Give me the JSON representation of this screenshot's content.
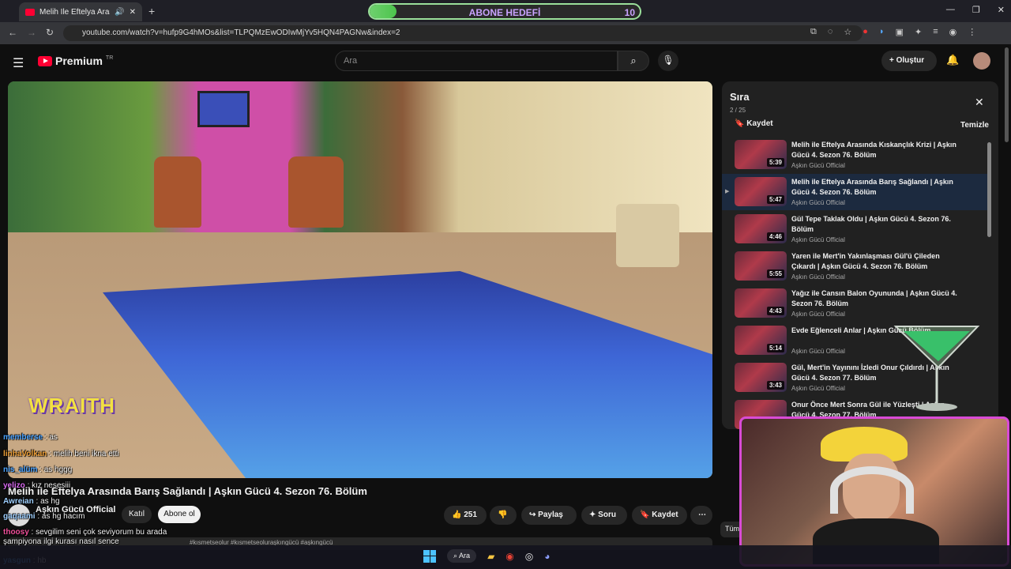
{
  "browser": {
    "tab_title": "Melih İle Eftelya Arasında B",
    "url": "youtube.com/watch?v=hufp9G4hMOs&list=TLPQMzEwODIwMjYv5HQN4PAGNw&index=2"
  },
  "overlay": {
    "sub_goal_label": "ABONE HEDEFİ",
    "sub_goal_count": "10",
    "sub_goal_progress": 0.1,
    "wraith_text": "WRAITH"
  },
  "header": {
    "logo_text": "Premium",
    "logo_region": "TR",
    "search_placeholder": "Ara",
    "create_label": "Oluştur"
  },
  "video": {
    "title": "Melih ile Eftelya Arasında Barış Sağlandı | Aşkın Gücü 4. Sezon 76. Bölüm",
    "channel": "Aşkın Gücü Official",
    "join_label": "Katıl",
    "subscribe_label": "Abone ol",
    "likes": "251",
    "share_label": "Paylaş",
    "ask_label": "Soru",
    "save_label": "Kaydet",
    "description_tags": "#kısmetseolur #kısmetseoluraşkıngücü #aşkıngücü"
  },
  "queue": {
    "title": "Sıra",
    "position": "2 / 25",
    "save_label": "Kaydet",
    "clear_label": "Temizle",
    "items": [
      {
        "title": "Melih ile Eftelya Arasında Kıskançlık Krizi | Aşkın Gücü 4. Sezon 76. Bölüm",
        "channel": "Aşkın Gücü Official",
        "duration": "5:39"
      },
      {
        "title": "Melih ile Eftelya Arasında Barış Sağlandı | Aşkın Gücü 4. Sezon 76. Bölüm",
        "channel": "Aşkın Gücü Official",
        "duration": "5:47"
      },
      {
        "title": "Gül Tepe Taklak Oldu | Aşkın Gücü 4. Sezon 76. Bölüm",
        "channel": "Aşkın Gücü Official",
        "duration": "4:46"
      },
      {
        "title": "Yaren ile Mert'in Yakınlaşması Gül'ü Çileden Çıkardı | Aşkın Gücü 4. Sezon 76. Bölüm",
        "channel": "Aşkın Gücü Official",
        "duration": "5:55"
      },
      {
        "title": "Yağız ile Cansın Balon Oyununda | Aşkın Gücü 4. Sezon 76. Bölüm",
        "channel": "Aşkın Gücü Official",
        "duration": "4:43"
      },
      {
        "title": "Evde Eğlenceli Anlar | Aşkın Gücü Bölüm",
        "channel": "Aşkın Gücü Official",
        "duration": "5:14"
      },
      {
        "title": "Gül, Mert'in Yayınını İzledi Onur Çıldırdı | Aşkın Gücü 4. Sezon 77. Bölüm",
        "channel": "Aşkın Gücü Official",
        "duration": "3:43"
      },
      {
        "title": "Onur Önce Mert Sonra Gül ile Yüzleşti | Aşkın Gücü 4. Sezon 77. Bölüm",
        "channel": "",
        "duration": ""
      }
    ]
  },
  "chat": [
    {
      "user": "memberse",
      "text": "as"
    },
    {
      "user": "linhaVolkan",
      "text": "melih beni ikna etti"
    },
    {
      "user": "nis_alüm",
      "text": "as hggg"
    },
    {
      "user": "yelizo",
      "text": "kız nesesiii"
    },
    {
      "user": "Awreian",
      "text": "as hg"
    },
    {
      "user": "gaqaami",
      "text": "as hg hacım"
    },
    {
      "user": "thoosy",
      "text": "sevgilim seni çok seviyorum bu arada şampiyona ilgi kurası nasıl sence"
    },
    {
      "user": "yasgun",
      "text": "hb"
    }
  ],
  "taskbar": {
    "search_label": "Ara"
  },
  "misc": {
    "tum_label": "Tüm"
  },
  "colors": {
    "accent": "#ff0033",
    "goal_fill": "#4cc44c",
    "cam_border": "#d94bd6"
  }
}
